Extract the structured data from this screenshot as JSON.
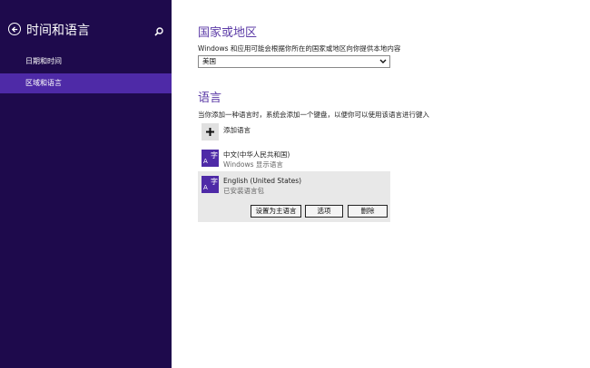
{
  "sidebar": {
    "title": "时间和语言",
    "items": [
      {
        "label": "日期和时间",
        "active": false
      },
      {
        "label": "区域和语言",
        "active": true
      }
    ]
  },
  "region": {
    "heading": "国家或地区",
    "description": "Windows 和应用可能会根据你所在的国家或地区向你提供本地内容",
    "selected_value": "美国"
  },
  "language": {
    "heading": "语言",
    "description": "当你添加一种语言时，系统会添加一个键盘，以便你可以使用该语言进行键入",
    "add_label": "添加语言",
    "items": [
      {
        "name": "中文(中华人民共和国)",
        "status": "Windows 显示语言",
        "badge_a": "A",
        "badge_z": "字"
      },
      {
        "name": "English (United States)",
        "status": "已安装语言包",
        "badge_a": "A",
        "badge_z": "字"
      }
    ],
    "buttons": {
      "set_primary": "设置为主语言",
      "options": "选项",
      "remove": "删除"
    }
  },
  "colors": {
    "sidebar_bg": "#1e0a4c",
    "active_bg": "#4e2aa7",
    "heading": "#5b3aa6"
  }
}
